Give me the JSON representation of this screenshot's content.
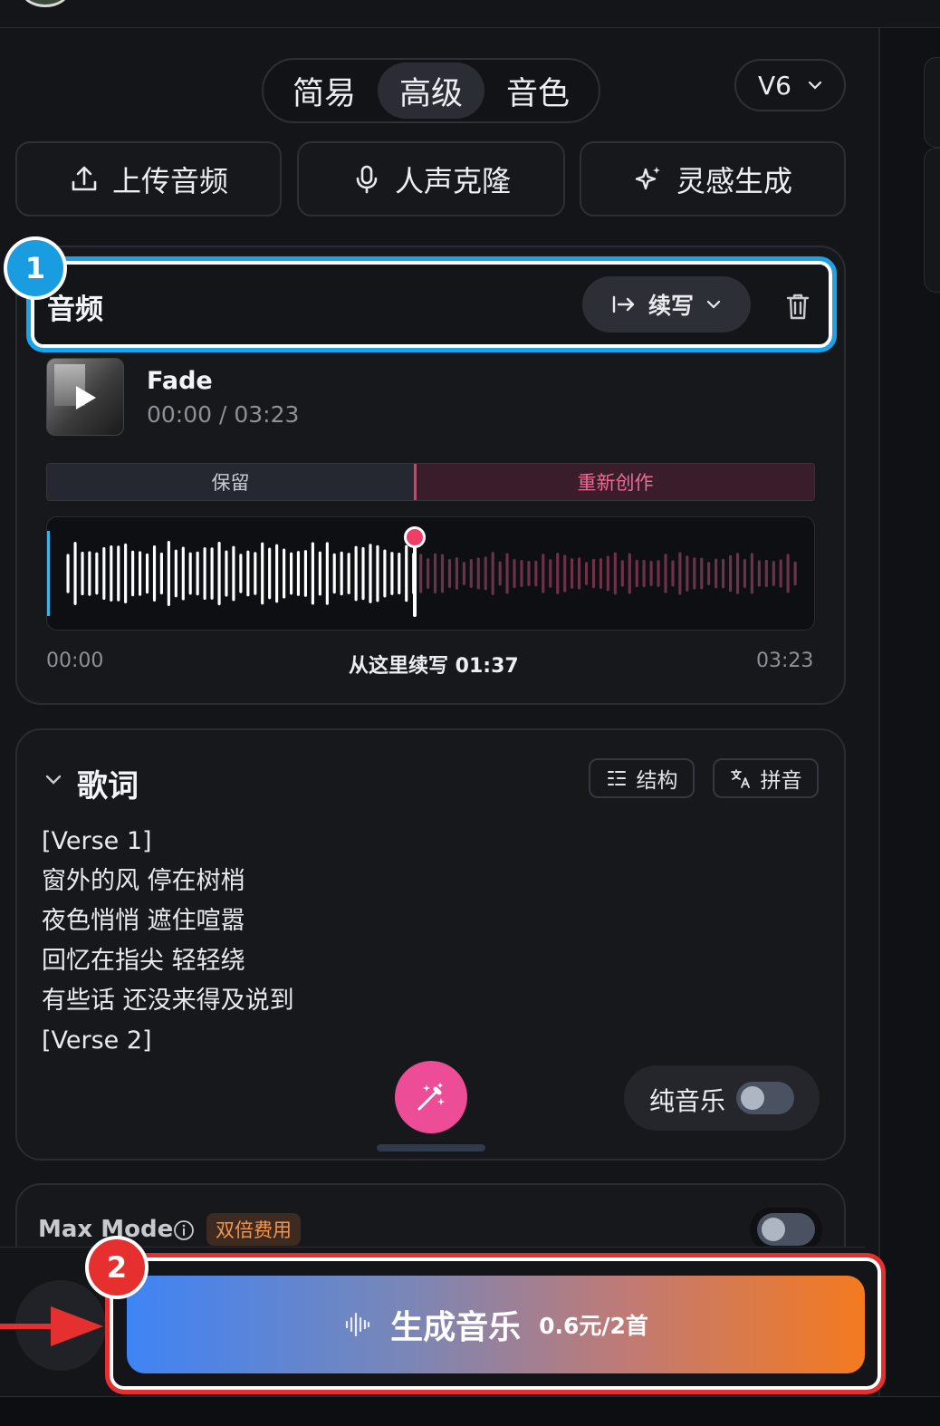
{
  "modes": {
    "tabs": [
      "简易",
      "高级",
      "音色"
    ],
    "active": "高级",
    "version": "V6"
  },
  "actions": {
    "upload": "上传音频",
    "voice_clone": "人声克隆",
    "inspiration": "灵感生成"
  },
  "audio": {
    "title": "音频",
    "extend_label": "续写",
    "track_name": "Fade",
    "track_time": "00:00 / 03:23",
    "keep_label": "保留",
    "recreate_label": "重新创作",
    "time_start": "00:00",
    "extend_from": "从这里续写 01:37",
    "time_end": "03:23",
    "extend_fraction": 0.478
  },
  "lyrics": {
    "title": "歌词",
    "structure_label": "结构",
    "pinyin_label": "拼音",
    "lines": [
      "[Verse 1]",
      "窗外的风 停在树梢",
      "夜色悄悄 遮住喧嚣",
      "回忆在指尖 轻轻绕",
      "有些话 还没来得及说到",
      "[Verse 2]"
    ],
    "instrumental_label": "纯音乐",
    "instrumental_on": false
  },
  "max_mode": {
    "label": "Max Mode",
    "badge": "双倍费用",
    "enabled": false
  },
  "generate": {
    "label": "生成音乐",
    "price": "0.6元/2首"
  },
  "annotations": {
    "step1": "1",
    "step2": "2"
  },
  "colors": {
    "step1_highlight": "#1aa3e8",
    "step2_highlight": "#e62f2f",
    "played_wave": "#ffffff",
    "unplayed_wave": "#6e3247",
    "accent_pink": "#ec4d96"
  }
}
